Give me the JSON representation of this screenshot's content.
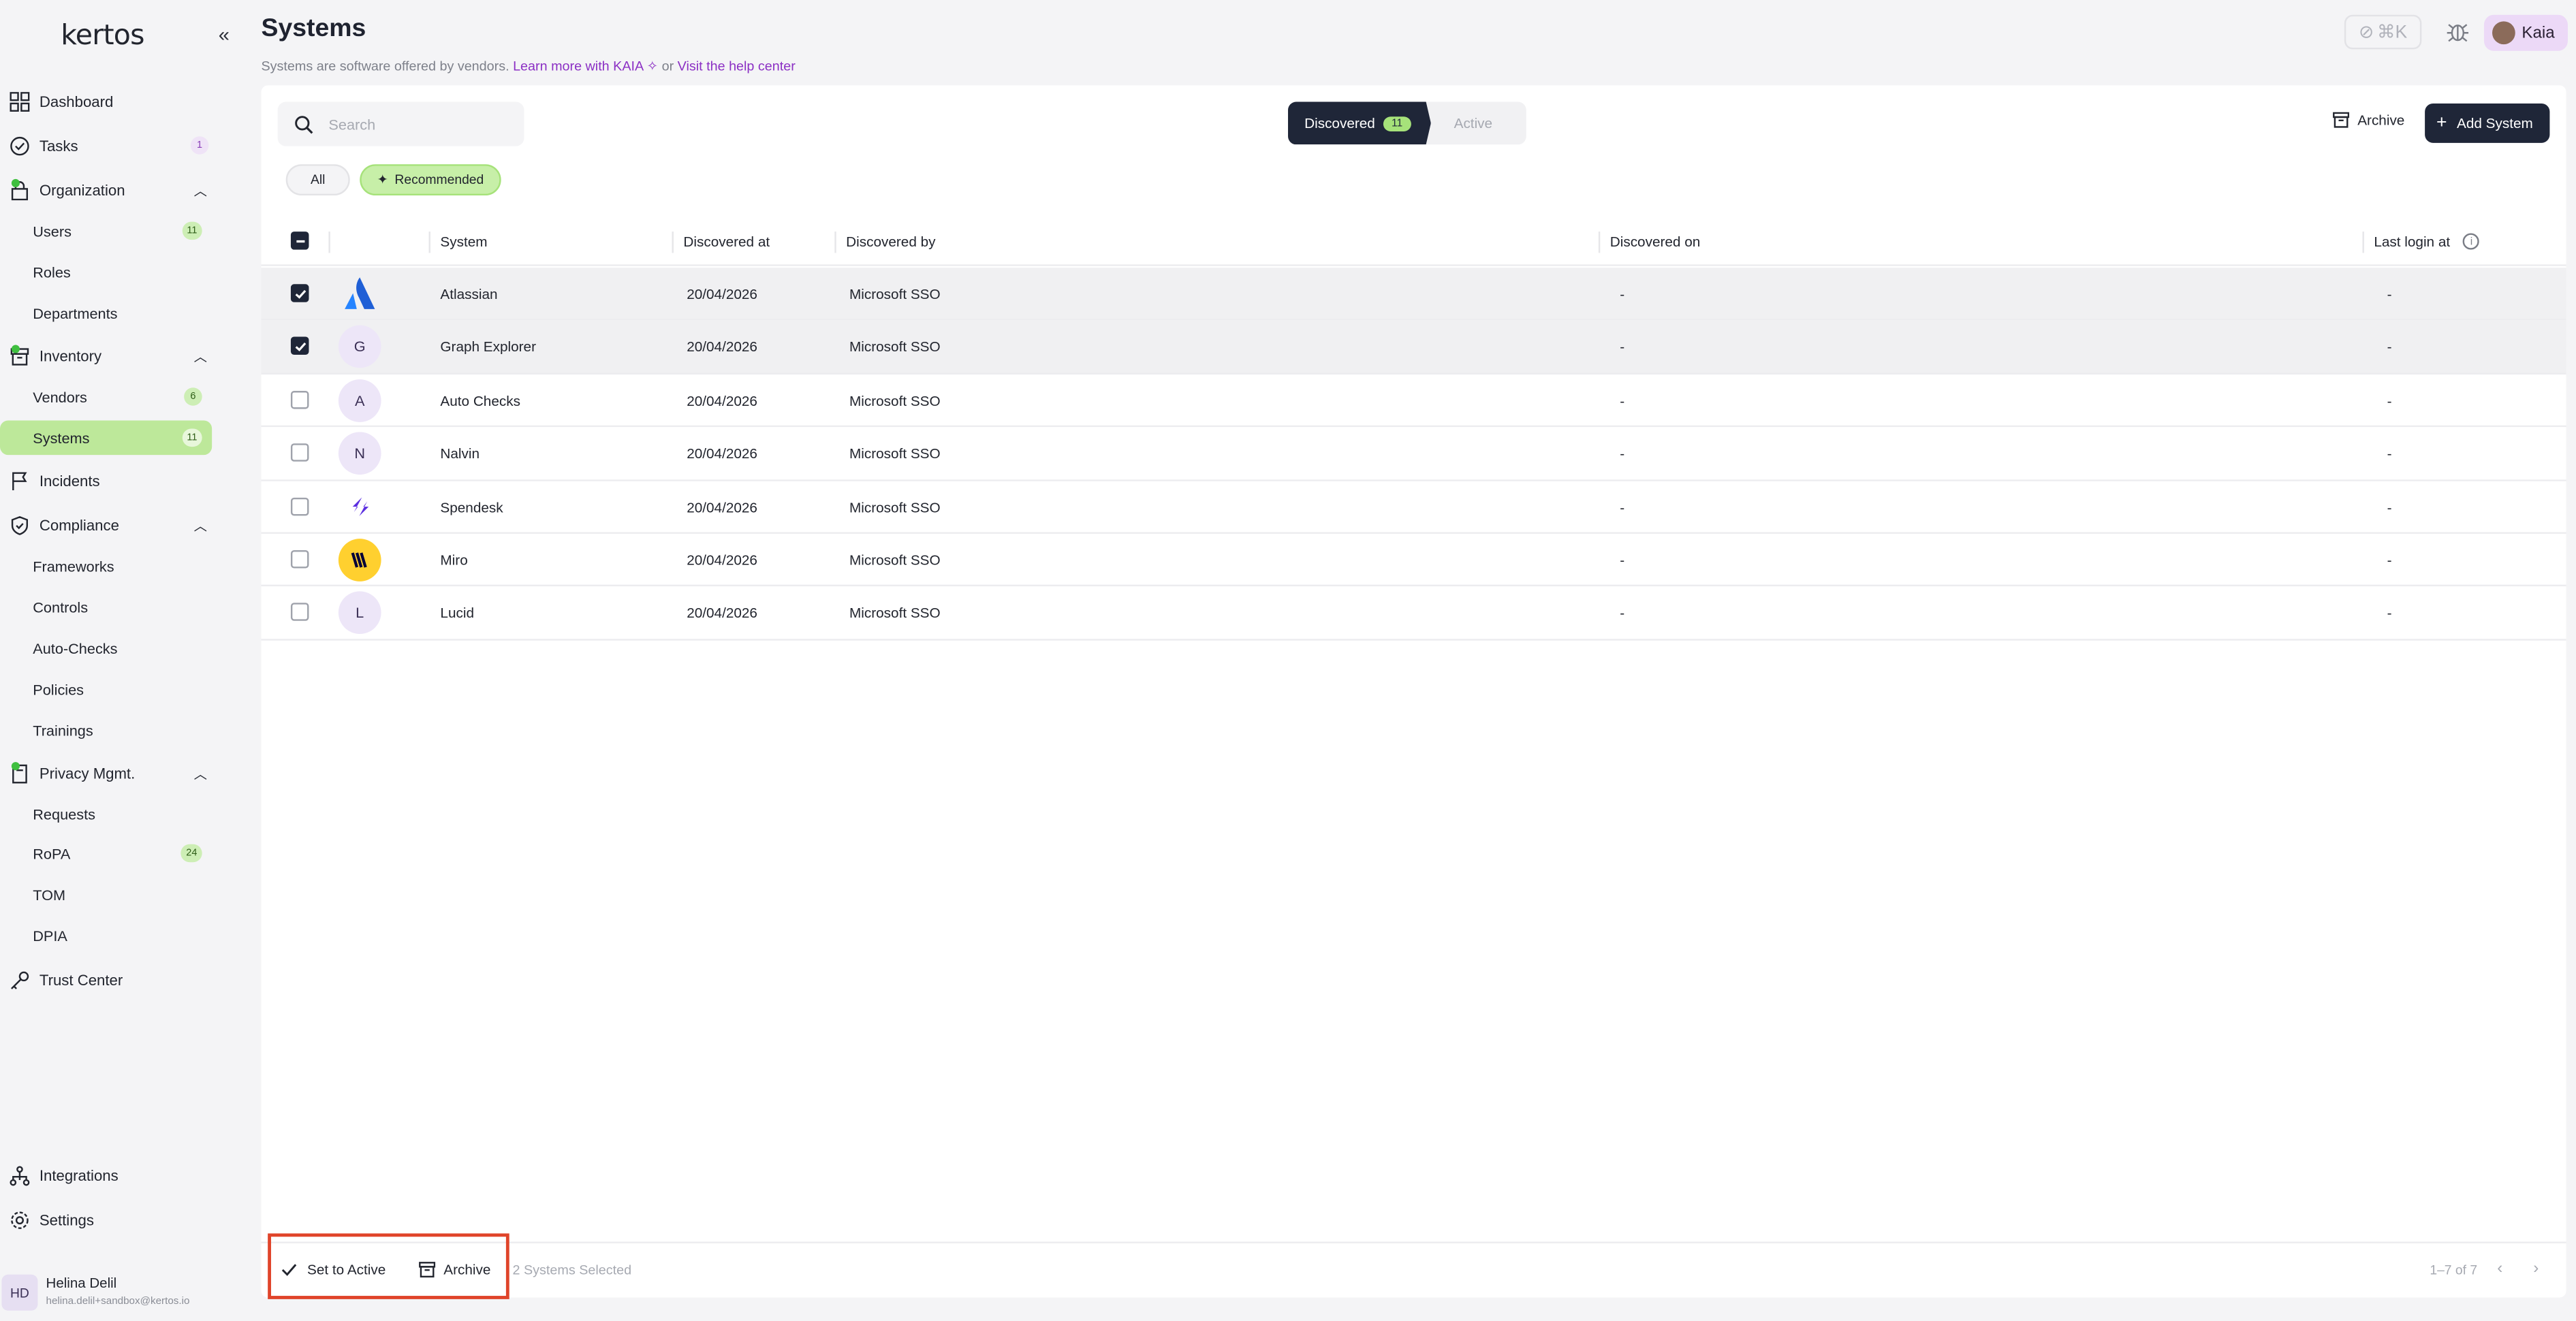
{
  "app": {
    "logo": "kertos"
  },
  "sidebar": {
    "dashboard": "Dashboard",
    "tasks": {
      "label": "Tasks",
      "badge": "1"
    },
    "organization": "Organization",
    "users": {
      "label": "Users",
      "badge": "11"
    },
    "roles": "Roles",
    "departments": "Departments",
    "inventory": "Inventory",
    "vendors": {
      "label": "Vendors",
      "badge": "6"
    },
    "systems": {
      "label": "Systems",
      "badge": "11"
    },
    "incidents": "Incidents",
    "compliance": "Compliance",
    "frameworks": "Frameworks",
    "controls": "Controls",
    "autochecks": "Auto-Checks",
    "policies": "Policies",
    "trainings": "Trainings",
    "privacy": "Privacy Mgmt.",
    "requests": "Requests",
    "ropa": {
      "label": "RoPA",
      "badge": "24"
    },
    "tom": "TOM",
    "dpia": "DPIA",
    "trust": "Trust Center",
    "integrations": "Integrations",
    "settings": "Settings",
    "user": {
      "initials": "HD",
      "name": "Helina Delil",
      "email": "helina.delil+sandbox@kertos.io"
    }
  },
  "header": {
    "title": "Systems",
    "subtitle": "Systems are software offered by vendors.",
    "link1": "Learn more with KAIA",
    "or": "or",
    "link2": "Visit the help center",
    "shortcut": "⌘K",
    "kaia": "Kaia"
  },
  "toolbar": {
    "search_placeholder": "Search",
    "tab_discovered": "Discovered",
    "tab_discovered_count": "11",
    "tab_active": "Active",
    "archive": "Archive",
    "add_system": "Add System",
    "filter_all": "All",
    "filter_recommended": "Recommended"
  },
  "table": {
    "columns": [
      "System",
      "Discovered at",
      "Discovered by",
      "Discovered on",
      "Last login at"
    ],
    "rows": [
      {
        "logo": "atlassian",
        "initial": "",
        "system": "Atlassian",
        "discovered_at": "20/04/2026",
        "discovered_by": "Microsoft SSO",
        "discovered_on": "-",
        "last_login": "-",
        "selected": true
      },
      {
        "logo": "letter",
        "initial": "G",
        "system": "Graph Explorer",
        "discovered_at": "20/04/2026",
        "discovered_by": "Microsoft SSO",
        "discovered_on": "-",
        "last_login": "-",
        "selected": true
      },
      {
        "logo": "letter",
        "initial": "A",
        "system": "Auto Checks",
        "discovered_at": "20/04/2026",
        "discovered_by": "Microsoft SSO",
        "discovered_on": "-",
        "last_login": "-",
        "selected": false
      },
      {
        "logo": "letter",
        "initial": "N",
        "system": "Nalvin",
        "discovered_at": "20/04/2026",
        "discovered_by": "Microsoft SSO",
        "discovered_on": "-",
        "last_login": "-",
        "selected": false
      },
      {
        "logo": "spendesk",
        "initial": "",
        "system": "Spendesk",
        "discovered_at": "20/04/2026",
        "discovered_by": "Microsoft SSO",
        "discovered_on": "-",
        "last_login": "-",
        "selected": false
      },
      {
        "logo": "miro",
        "initial": "",
        "system": "Miro",
        "discovered_at": "20/04/2026",
        "discovered_by": "Microsoft SSO",
        "discovered_on": "-",
        "last_login": "-",
        "selected": false
      },
      {
        "logo": "letter",
        "initial": "L",
        "system": "Lucid",
        "discovered_at": "20/04/2026",
        "discovered_by": "Microsoft SSO",
        "discovered_on": "-",
        "last_login": "-",
        "selected": false
      }
    ]
  },
  "footer": {
    "set_active": "Set to Active",
    "archive": "Archive",
    "selected": "2 Systems Selected",
    "range": "1–7 of 7"
  },
  "colors": {
    "accent_green": "#bde89a",
    "dark": "#1f2638",
    "link_purple": "#8b2fc4",
    "highlight_red": "#e0442a"
  }
}
